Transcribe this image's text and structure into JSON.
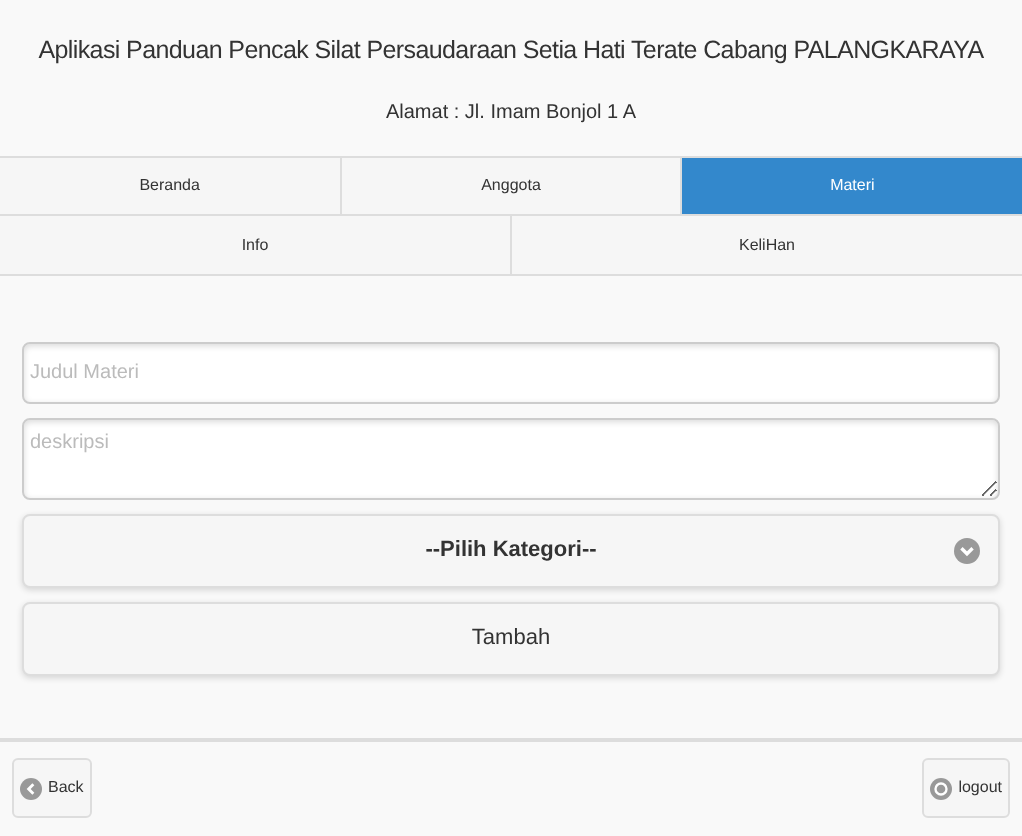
{
  "header": {
    "title": "Aplikasi Panduan Pencak Silat Persaudaraan Setia Hati Terate Cabang PALANGKARAYA",
    "address": "Alamat : Jl. Imam Bonjol 1 A"
  },
  "tabs": [
    {
      "label": "Beranda",
      "selected": false
    },
    {
      "label": "Anggota",
      "selected": false
    },
    {
      "label": "Materi",
      "selected": true
    }
  ],
  "subtabs": [
    {
      "label": "Info",
      "selected": false
    },
    {
      "label": "KeliHan",
      "selected": false
    }
  ],
  "form": {
    "title_field": {
      "placeholder": "Judul Materi"
    },
    "description_field": {
      "placeholder": "deskripsi"
    },
    "category_select": {
      "value": "--Pilih Kategori--"
    },
    "submit_button": "Tambah"
  },
  "footer": {
    "back_button": "Back",
    "logout_button": "logout"
  }
}
